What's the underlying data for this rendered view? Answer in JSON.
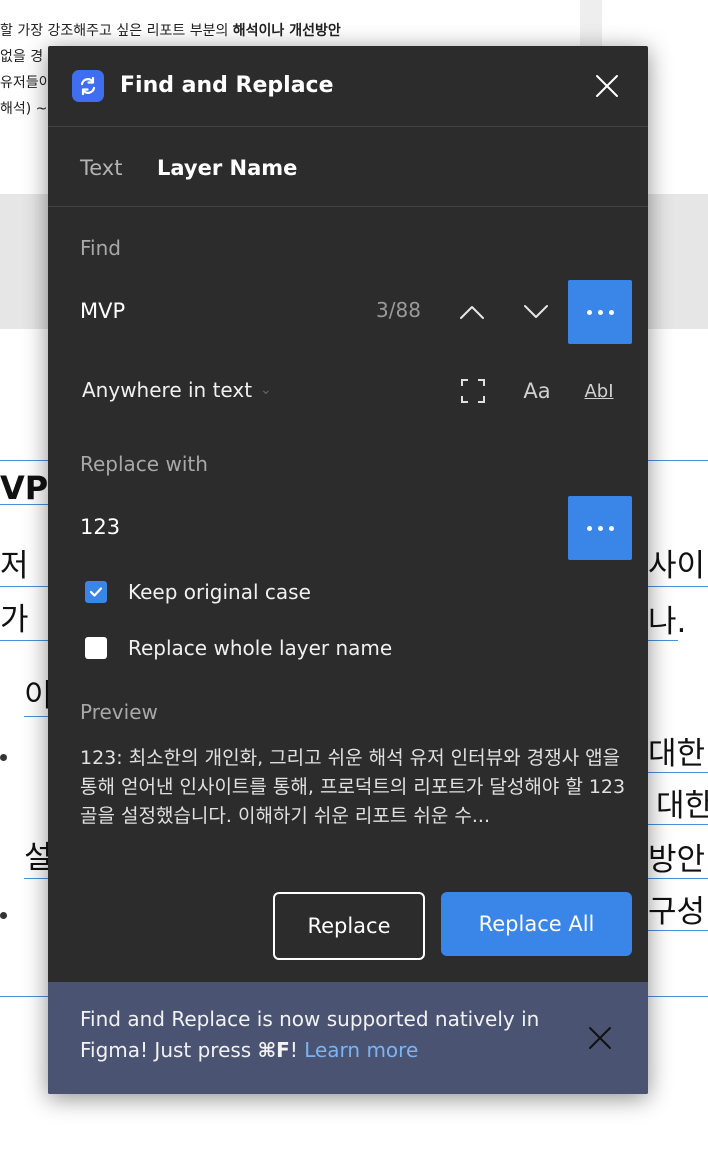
{
  "background": {
    "top_lines": [
      "할 가장 강조해주고 싶은 리포트 부분의",
      "해석이나 개선방안",
      "없을 경",
      "유저들이",
      "해석) ~"
    ],
    "heading_fragment": "VP",
    "left_fragments": [
      "저",
      "가",
      "이",
      "설"
    ],
    "right_fragments": [
      "사이",
      "나.",
      "대한",
      "대한",
      "방안",
      "구성"
    ]
  },
  "panel": {
    "title": "Find and Replace",
    "icon": "find-replace-icon",
    "tabs": [
      {
        "label": "Text",
        "active": false
      },
      {
        "label": "Layer Name",
        "active": true
      }
    ],
    "find": {
      "label": "Find",
      "value": "MVP",
      "match_count": "3/88",
      "scope": "Anywhere in text",
      "option_icons": [
        "whole-word-icon",
        "match-case-icon",
        "regex-icon"
      ],
      "match_case_glyph": "Aa",
      "regex_glyph": "AbI"
    },
    "replace": {
      "label": "Replace with",
      "value": "123"
    },
    "options": [
      {
        "label": "Keep original case",
        "checked": true
      },
      {
        "label": "Replace whole layer name",
        "checked": false
      }
    ],
    "preview": {
      "label": "Preview",
      "text": "123: 최소한의 개인화, 그리고 쉬운 해석 유저 인터뷰와 경쟁사 앱을 통해 얻어낸 인사이트를 통해, 프로덕트의 리포트가 달성해야 할 123 골을 설정했습니다. 이해하기 쉬운 리포트 쉬운 수..."
    },
    "buttons": {
      "replace": "Replace",
      "replace_all": "Replace All"
    },
    "notice": {
      "text_before": "Find and Replace is now supported natively in Figma! Just press ",
      "shortcut": "⌘F",
      "text_after": "! ",
      "link": "Learn more"
    },
    "colors": {
      "panel_bg": "#2c2c2c",
      "accent": "#3a86e8",
      "notice_bg": "#4a5472",
      "link": "#7ab4f5"
    }
  }
}
